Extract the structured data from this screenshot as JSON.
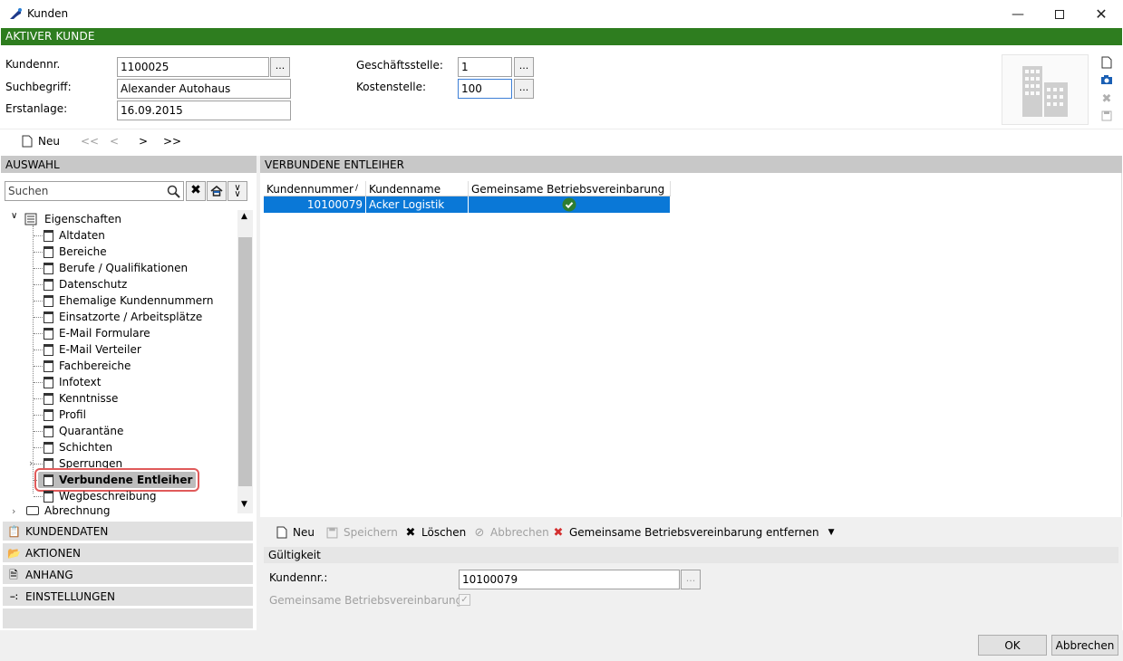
{
  "window": {
    "title": "Kunden"
  },
  "banner": {
    "label": "AKTIVER KUNDE"
  },
  "header": {
    "kundennr_label": "Kundennr.",
    "kundennr_value": "1100025",
    "suchbegriff_label": "Suchbegriff:",
    "suchbegriff_value": "Alexander Autohaus",
    "erstanlage_label": "Erstanlage:",
    "erstanlage_value": "16.09.2015",
    "geschaeftsstelle_label": "Geschäftsstelle:",
    "geschaeftsstelle_value": "1",
    "kostenstelle_label": "Kostenstelle:",
    "kostenstelle_value": "100",
    "dots": "..."
  },
  "nav": {
    "new_label": "Neu",
    "first": "<<",
    "prev": "<",
    "next": ">",
    "last": ">>"
  },
  "auswahl": {
    "title": "AUSWAHL",
    "search_placeholder": "Suchen",
    "tree_root": "Eigenschaften",
    "tree_items": [
      "Altdaten",
      "Bereiche",
      "Berufe / Qualifikationen",
      "Datenschutz",
      "Ehemalige Kundennummern",
      "Einsatzorte / Arbeitsplätze",
      "E-Mail Formulare",
      "E-Mail Verteiler",
      "Fachbereiche",
      "Infotext",
      "Kenntnisse",
      "Profil",
      "Quarantäne",
      "Schichten",
      "Sperrungen",
      "Verbundene Entleiher",
      "Wegbeschreibung"
    ],
    "selected_item": "Verbundene Entleiher",
    "tree_next_root": "Abrechnung",
    "accordion": [
      "KUNDENDATEN",
      "AKTIONEN",
      "ANHANG",
      "EINSTELLUNGEN"
    ]
  },
  "main": {
    "title": "VERBUNDENE ENTLEIHER",
    "columns": [
      "Kundennummer",
      "Kundenname",
      "Gemeinsame Betriebsvereinbarung"
    ],
    "sort_indicator": "/",
    "rows": [
      {
        "kundennummer": "10100079",
        "kundenname": "Acker Logistik",
        "gemeinsam": true
      }
    ],
    "toolbar": {
      "neu": "Neu",
      "speichern": "Speichern",
      "loeschen": "Löschen",
      "abbrechen": "Abbrechen",
      "entfernen": "Gemeinsame Betriebsvereinbarung entfernen"
    },
    "section_title": "Gültigkeit",
    "detail": {
      "kundennr_label": "Kundennr.:",
      "kundennr_value": "10100079",
      "gemeinsam_label": "Gemeinsame Betriebsvereinbarung:",
      "dots": "..."
    }
  },
  "footer": {
    "ok": "OK",
    "abbrechen": "Abbrechen"
  },
  "colors": {
    "banner": "#2e7d1f",
    "selection": "#0a78d7",
    "check": "#2e7d32"
  }
}
